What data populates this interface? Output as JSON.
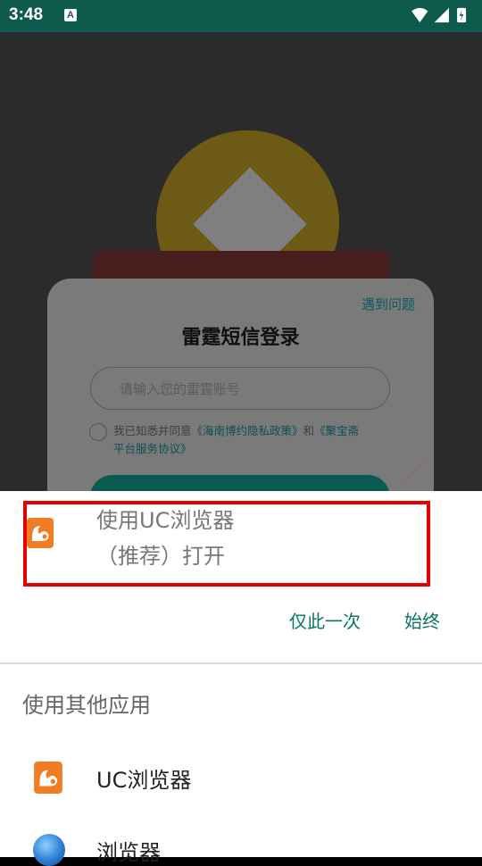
{
  "status_bar": {
    "time": "3:48",
    "notification_icon": "A"
  },
  "card": {
    "help_link": "遇到问题",
    "title": "雷霆短信登录",
    "input_placeholder": "请输入您的雷霆账号",
    "agree_prefix": "我已知悉并同意",
    "privacy_link": "《海南博约隐私政策》",
    "agree_and": "和",
    "service_link_1": "《聚宝斋",
    "service_link_2": "平台服务协议》"
  },
  "sheet": {
    "open_line1": "使用UC浏览器",
    "open_line2": "（推荐）打开",
    "just_once": "仅此一次",
    "always": "始终",
    "other_apps_label": "使用其他应用",
    "apps": [
      {
        "label": "UC浏览器",
        "icon": "uc-browser-icon"
      },
      {
        "label": "浏览器",
        "icon": "browser-globe-icon"
      }
    ]
  },
  "colors": {
    "status_bar": "#0e5a4d",
    "accent": "#0b7462",
    "highlight": "#e50000",
    "uc_orange": "#f07c24"
  }
}
